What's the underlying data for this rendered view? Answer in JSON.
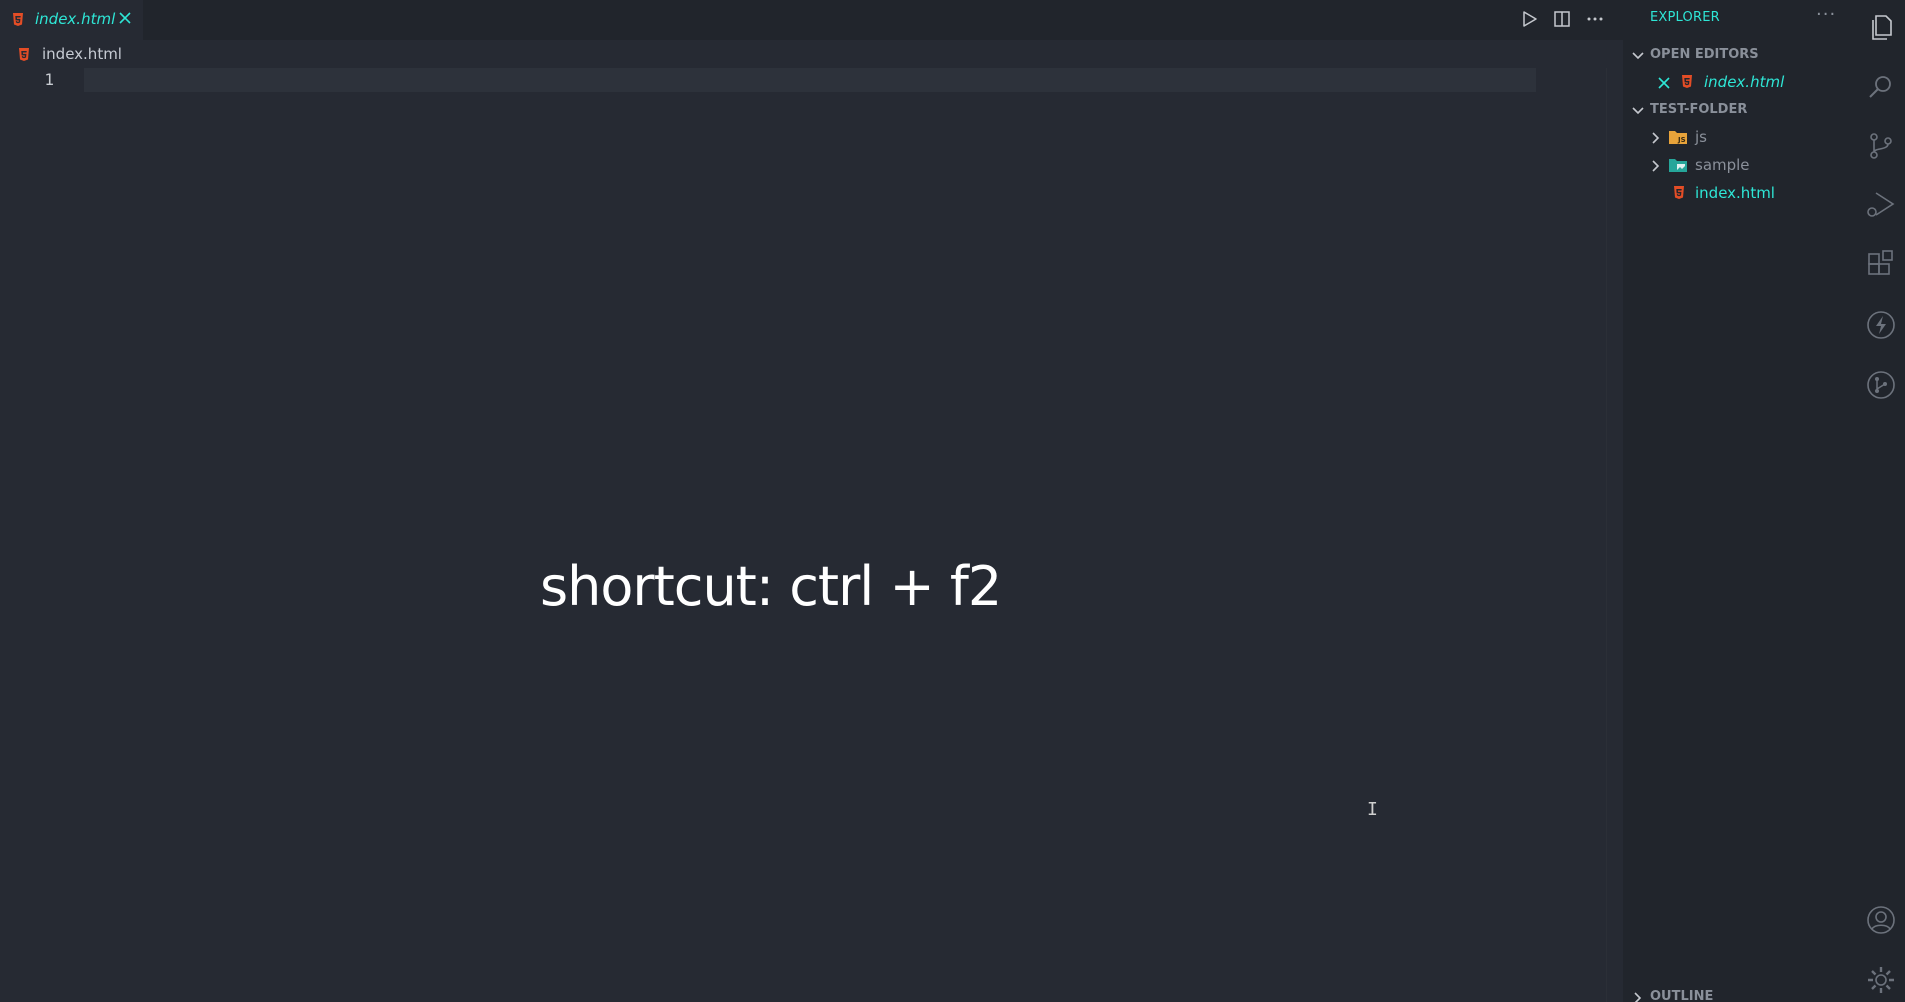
{
  "tab": {
    "label": "index.html",
    "icon": "html5-icon",
    "accent": "#2ee6d6"
  },
  "editor_actions": [
    "run-icon",
    "split-editor-icon",
    "more-actions-icon"
  ],
  "breadcrumb": {
    "label": "index.html"
  },
  "editor": {
    "line_numbers": [
      "1"
    ]
  },
  "overlay": {
    "text": "shortcut: ctrl + f2"
  },
  "explorer": {
    "title": "EXPLORER",
    "more": "···",
    "open_editors": {
      "label": "OPEN EDITORS",
      "items": [
        {
          "label": "index.html"
        }
      ]
    },
    "folder": {
      "label": "TEST-FOLDER",
      "items": [
        {
          "label": "js",
          "icon": "js-folder-icon"
        },
        {
          "label": "sample",
          "icon": "image-folder-icon"
        },
        {
          "label": "index.html",
          "icon": "html5-icon"
        }
      ]
    },
    "outline": {
      "label": "OUTLINE"
    }
  },
  "activity_bar": {
    "top": [
      "explorer-icon",
      "search-icon",
      "source-control-icon",
      "run-debug-icon",
      "extensions-icon",
      "lightning-icon",
      "git-graph-icon"
    ],
    "bottom": [
      "account-icon",
      "settings-gear-icon"
    ]
  },
  "colors": {
    "editor_bg": "#262a33",
    "sidebar_bg": "#21252c",
    "accent": "#2ee6d6",
    "html_icon": "#e44d26"
  }
}
